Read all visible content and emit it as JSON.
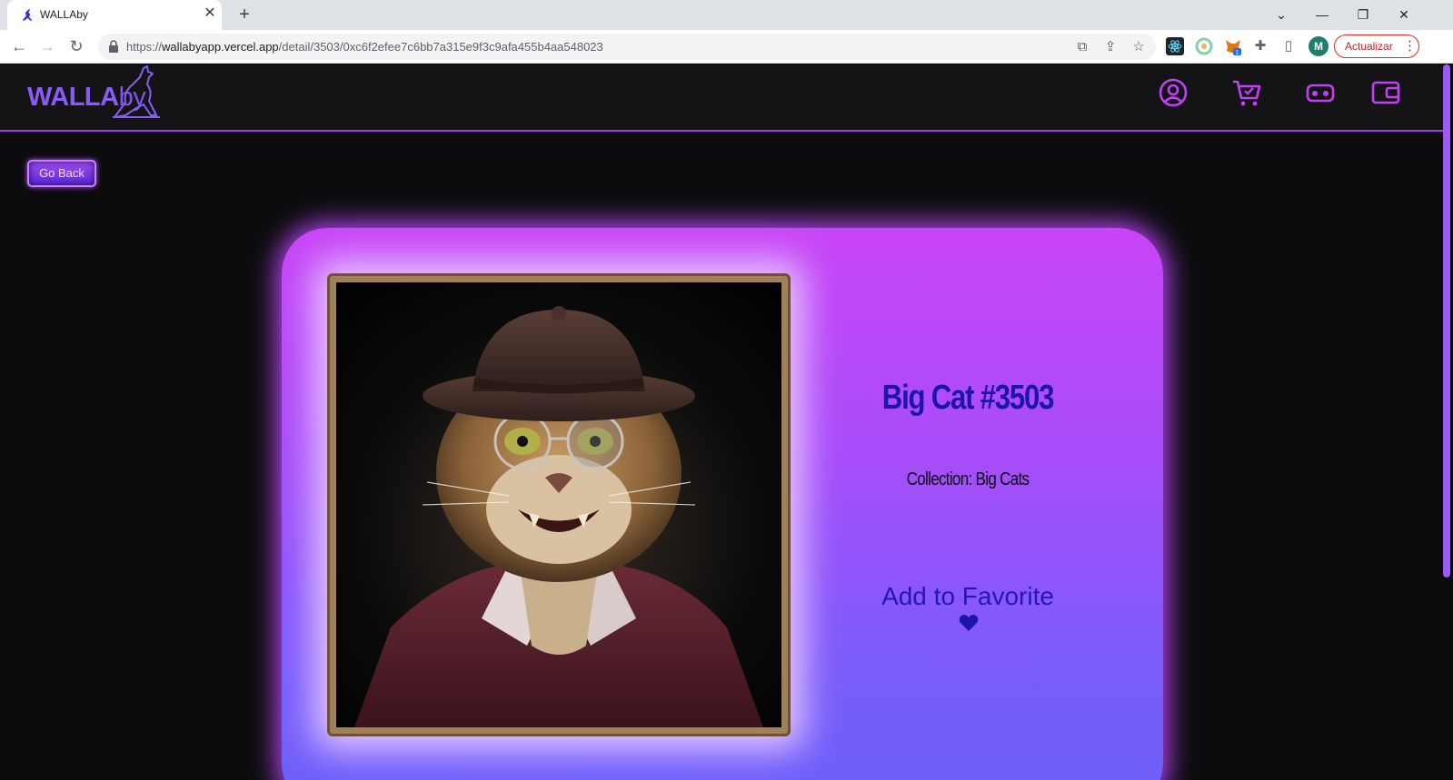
{
  "browser": {
    "tab_title": "WALLAby",
    "url_host": "wallabyapp.vercel.app",
    "url_path": "/detail/3503/0xc6f2efee7c6bb7a315e9f3c9afa455b4aa548023",
    "url_scheme": "https://",
    "profile_initial": "M",
    "update_label": "Actualizar",
    "extension_badge": "1"
  },
  "app": {
    "logo_primary": "WALLA",
    "logo_secondary": "by",
    "nav_icons": [
      "user-circle-icon",
      "shopping-cart-icon",
      "vr-headset-icon",
      "wallet-icon"
    ],
    "accent_color": "#9e3cf0"
  },
  "detail": {
    "go_back_label": "Go Back",
    "title": "Big Cat #3503",
    "collection": "Collection: Big Cats",
    "favorite_label": "Add to Favorite",
    "favorite_icon": "heart-icon"
  }
}
